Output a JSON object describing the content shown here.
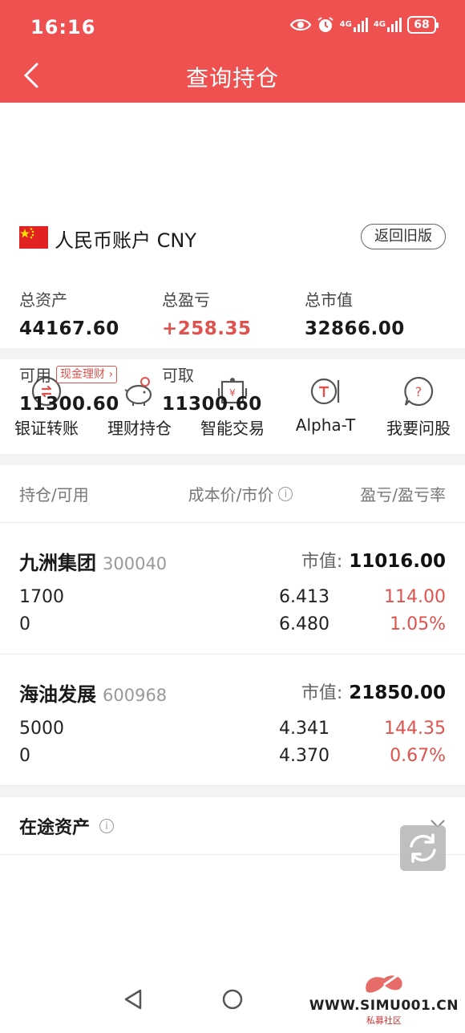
{
  "status_bar": {
    "time": "16:16",
    "net1": "4G",
    "net2": "4G",
    "battery": "68"
  },
  "header": {
    "title": "查询持仓"
  },
  "account": {
    "name": "人民币账户 CNY",
    "old_version_btn": "返回旧版",
    "total_assets_label": "总资产",
    "total_assets": "44167.60",
    "total_pl_label": "总盈亏",
    "total_pl": "+258.35",
    "market_value_label": "总市值",
    "market_value": "32866.00",
    "available_label": "可用",
    "cash_tag": "现金理财",
    "available": "11300.60",
    "withdrawable_label": "可取",
    "withdrawable": "11300.60"
  },
  "quick_actions": [
    {
      "label": "银证转账",
      "icon": "transfer-icon"
    },
    {
      "label": "理财持仓",
      "icon": "piggy-bank-icon"
    },
    {
      "label": "智能交易",
      "icon": "smart-trade-icon"
    },
    {
      "label": "Alpha-T",
      "icon": "alpha-t-icon"
    },
    {
      "label": "我要问股",
      "icon": "question-icon"
    }
  ],
  "table_header": {
    "col1": "持仓/可用",
    "col2": "成本价/市价",
    "col3": "盈亏/盈亏率"
  },
  "positions": [
    {
      "name": "九洲集团",
      "code": "300040",
      "mv_label": "市值:",
      "market_value": "11016.00",
      "holding": "1700",
      "available": "0",
      "cost": "6.413",
      "price": "6.480",
      "pl": "114.00",
      "pl_rate": "1.05%"
    },
    {
      "name": "海油发展",
      "code": "600968",
      "mv_label": "市值:",
      "market_value": "21850.00",
      "holding": "5000",
      "available": "0",
      "cost": "4.341",
      "price": "4.370",
      "pl": "144.35",
      "pl_rate": "0.67%"
    }
  ],
  "transit": {
    "label": "在途资产"
  },
  "watermark": {
    "url": "WWW.SIMU001.CN",
    "sub": "私募社区"
  },
  "colors": {
    "brand": "#ef5050",
    "profit": "#e0524d"
  }
}
